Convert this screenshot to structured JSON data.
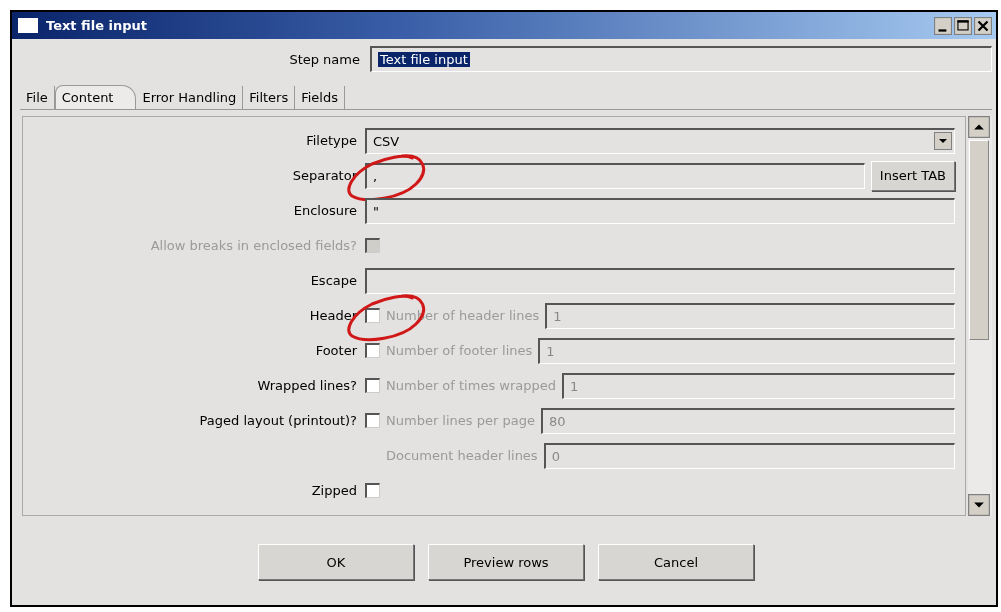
{
  "window": {
    "title": "Text file input"
  },
  "step_name": {
    "label": "Step name",
    "value": "Text file input"
  },
  "tabs": [
    {
      "label": "File",
      "selected": false
    },
    {
      "label": "Content",
      "selected": true
    },
    {
      "label": "Error Handling",
      "selected": false
    },
    {
      "label": "Filters",
      "selected": false
    },
    {
      "label": "Fields",
      "selected": false
    }
  ],
  "rows": [
    {
      "kind": "dropdown",
      "label": "Filetype",
      "value": "CSV",
      "circled": false
    },
    {
      "kind": "field-button",
      "label": "Separator",
      "value": ",",
      "button": "Insert TAB",
      "circled": true
    },
    {
      "kind": "field",
      "label": "Enclosure",
      "value": "\"",
      "circled": false
    },
    {
      "kind": "checkbox",
      "label": "Allow breaks in enclosed fields?",
      "checked": false,
      "disabled": true,
      "circled": false
    },
    {
      "kind": "field",
      "label": "Escape",
      "circled": false
    },
    {
      "kind": "checkbox-field",
      "label": "Header",
      "checked": false,
      "disabled": false,
      "sub_label": "Number of header lines",
      "value": "1",
      "circled": true
    },
    {
      "kind": "checkbox-field",
      "label": "Footer",
      "checked": false,
      "disabled": false,
      "sub_label": "Number of footer lines",
      "value": "1",
      "circled": false
    },
    {
      "kind": "checkbox-field",
      "label": "Wrapped lines?",
      "checked": false,
      "disabled": false,
      "sub_label": "Number of times wrapped",
      "value": "1",
      "circled": false
    },
    {
      "kind": "checkbox-field",
      "label": "Paged layout (printout)?",
      "checked": false,
      "disabled": false,
      "sub_label": "Number lines per page",
      "value": "80",
      "circled": false
    },
    {
      "kind": "sub-field",
      "sub_label": "Document header lines",
      "value": "0",
      "disabled": true,
      "circled": false
    },
    {
      "kind": "checkbox",
      "label": "Zipped",
      "checked": false,
      "disabled": false,
      "circled": false
    }
  ],
  "buttons": [
    "OK",
    "Preview rows",
    "Cancel"
  ]
}
